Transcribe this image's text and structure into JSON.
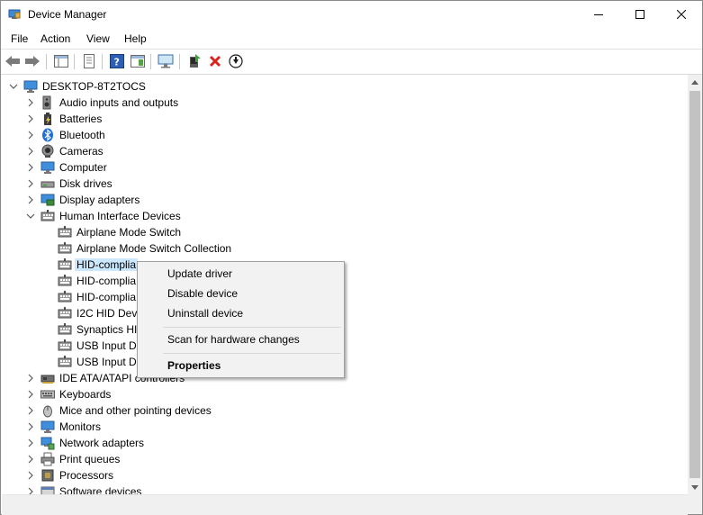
{
  "window": {
    "title": "Device Manager"
  },
  "menubar": {
    "items": [
      "File",
      "Action",
      "View",
      "Help"
    ]
  },
  "tree": {
    "root": "DESKTOP-8T2TOCS",
    "items": [
      {
        "label": "Audio inputs and outputs",
        "icon": "speaker-icon"
      },
      {
        "label": "Batteries",
        "icon": "battery-icon"
      },
      {
        "label": "Bluetooth",
        "icon": "bluetooth-icon"
      },
      {
        "label": "Cameras",
        "icon": "camera-icon"
      },
      {
        "label": "Computer",
        "icon": "computer-icon"
      },
      {
        "label": "Disk drives",
        "icon": "disk-drive-icon"
      },
      {
        "label": "Display adapters",
        "icon": "display-adapter-icon"
      },
      {
        "label": "Human Interface Devices",
        "icon": "hid-icon",
        "expanded": true
      },
      {
        "label": "Airplane Mode Switch",
        "icon": "hid-icon",
        "child": true
      },
      {
        "label": "Airplane Mode Switch Collection",
        "icon": "hid-icon",
        "child": true
      },
      {
        "label": "HID-complia",
        "icon": "hid-icon",
        "child": true,
        "selected": true
      },
      {
        "label": "HID-complia",
        "icon": "hid-icon",
        "child": true
      },
      {
        "label": "HID-complia",
        "icon": "hid-icon",
        "child": true
      },
      {
        "label": "I2C HID Devi",
        "icon": "hid-icon",
        "child": true
      },
      {
        "label": "Synaptics HI",
        "icon": "hid-icon",
        "child": true
      },
      {
        "label": "USB Input De",
        "icon": "hid-icon",
        "child": true
      },
      {
        "label": "USB Input De",
        "icon": "hid-icon",
        "child": true
      },
      {
        "label": "IDE ATA/ATAPI controllers",
        "icon": "ide-controller-icon"
      },
      {
        "label": "Keyboards",
        "icon": "keyboard-icon"
      },
      {
        "label": "Mice and other pointing devices",
        "icon": "mouse-icon"
      },
      {
        "label": "Monitors",
        "icon": "monitor-icon"
      },
      {
        "label": "Network adapters",
        "icon": "network-adapter-icon"
      },
      {
        "label": "Print queues",
        "icon": "printer-icon"
      },
      {
        "label": "Processors",
        "icon": "processor-icon"
      },
      {
        "label": "Software devices",
        "icon": "software-device-icon"
      }
    ]
  },
  "context_menu": {
    "update_driver": "Update driver",
    "disable_device": "Disable device",
    "uninstall_device": "Uninstall device",
    "scan_hardware": "Scan for hardware changes",
    "properties": "Properties"
  },
  "colors": {
    "selection": "#cce8ff",
    "menu_bg": "#f2f2f2",
    "accent": "#0078d7"
  }
}
